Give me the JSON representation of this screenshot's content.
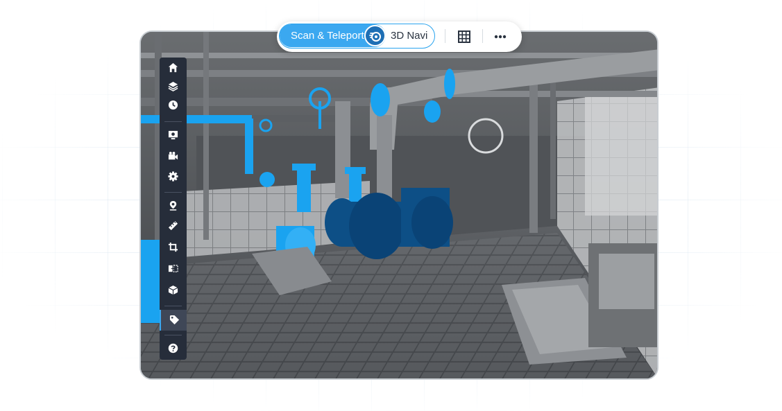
{
  "toolbar": {
    "mode_active_label": "Scan & Teleport",
    "mode_inactive_label": "3D Navi",
    "teleport_icon": "teleport-icon",
    "grid_icon": "grid-icon",
    "more_icon": "more-icon"
  },
  "sidebar": {
    "groups": [
      [
        "home-icon",
        "layers-icon",
        "history-icon"
      ],
      [
        "screen-capture-icon",
        "video-camera-icon",
        "settings-icon"
      ],
      [
        "location-pin-icon",
        "ruler-icon",
        "crop-icon",
        "compare-icon",
        "box-icon"
      ],
      [
        "tag-icon"
      ],
      [
        "help-icon"
      ]
    ],
    "active_item": "tag-icon"
  },
  "colors": {
    "accent": "#3ba8f0",
    "accent_dark": "#1e6fb5",
    "sidebar_bg": "#262d3a",
    "highlight_blue": "#1aa3f0",
    "highlight_navy": "#0d4f86"
  }
}
